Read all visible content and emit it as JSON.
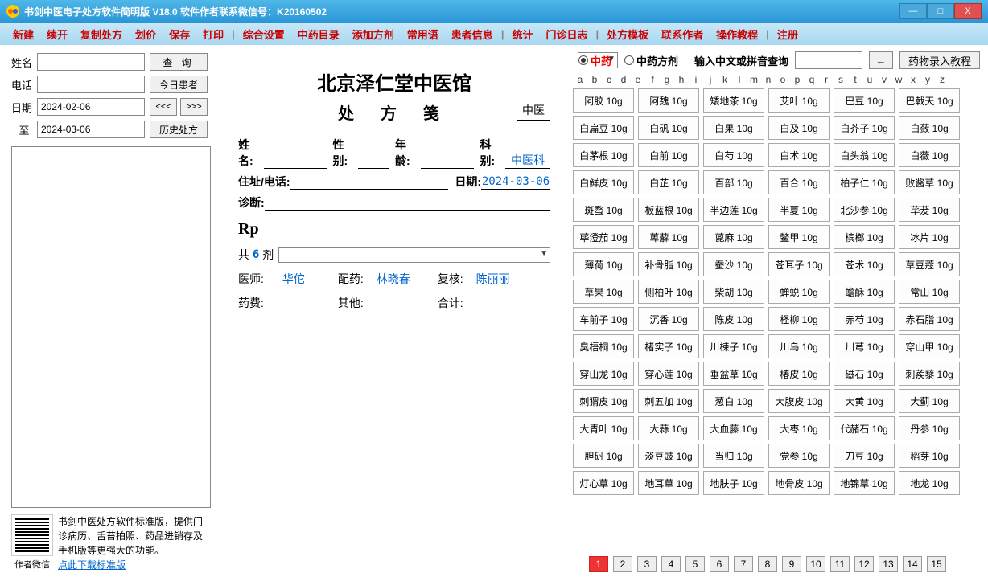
{
  "window": {
    "title": "书剑中医电子处方软件简明版    V18.0         软件作者联系微信号：K20160502",
    "btn_min": "—",
    "btn_max": "□",
    "btn_close": "X"
  },
  "menu": [
    "新建",
    "续开",
    "复制处方",
    "划价",
    "保存",
    "打印",
    "|",
    "综合设置",
    "中药目录",
    "添加方剂",
    "常用语",
    "患者信息",
    "|",
    "统计",
    "门诊日志",
    "|",
    "处方模板",
    "联系作者",
    "操作教程",
    "|",
    "注册"
  ],
  "left": {
    "name_label": "姓名",
    "phone_label": "电话",
    "date_label": "日期",
    "to_label": "至",
    "date_from": "2024-02-06",
    "date_to": "2024-03-06",
    "btn_query": "查   询",
    "btn_today": "今日患者",
    "btn_prev": "<<<",
    "btn_next": ">>>",
    "btn_history": "历史处方",
    "promo": "书剑中医处方软件标准版，提供门诊病历、舌苔拍照、药品进销存及手机版等更强大的功能。",
    "promo_link": "点此下载标准版",
    "qr_caption": "作者微信"
  },
  "rx": {
    "clinic": "北京泽仁堂中医馆",
    "title2": "处 方 笺",
    "stamp": "中医",
    "lab_name": "姓名:",
    "lab_sex": "性别:",
    "lab_age": "年龄:",
    "lab_dept": "科别:",
    "dept": "中医科",
    "lab_addr": "住址/电话:",
    "lab_date": "日期:",
    "date": "2024-03-06",
    "lab_diag": "诊断:",
    "rp": "Rp",
    "total_pre": "共",
    "total_n": "6",
    "total_suf": "剂",
    "lab_doc": "医师:",
    "doc": "华佗",
    "lab_disp": "配药:",
    "disp": "林晓春",
    "lab_check": "复核:",
    "check": "陈丽丽",
    "lab_fee": "药费:",
    "lab_other": "其他:",
    "lab_sum": "合计:"
  },
  "right": {
    "radio1": "中药",
    "radio2": "中药方剂",
    "search_label": "输入中文或拼音查询",
    "arrow": "←",
    "tutorial": "药物录入教程",
    "alpha": [
      "a",
      "b",
      "c",
      "d",
      "e",
      "f",
      "g",
      "h",
      "i",
      "j",
      "k",
      "l",
      "m",
      "n",
      "o",
      "p",
      "q",
      "r",
      "s",
      "t",
      "u",
      "v",
      "w",
      "x",
      "y",
      "z"
    ],
    "herbs": [
      [
        "阿胶 10g",
        "阿魏 10g",
        "矮地茶 10g",
        "艾叶 10g",
        "巴豆 10g",
        "巴戟天 10g"
      ],
      [
        "白扁豆 10g",
        "白矾 10g",
        "白果 10g",
        "白及 10g",
        "白芥子 10g",
        "白蔹 10g"
      ],
      [
        "白茅根 10g",
        "白前 10g",
        "白芍 10g",
        "白术 10g",
        "白头翁 10g",
        "白薇 10g"
      ],
      [
        "白鲜皮 10g",
        "白芷 10g",
        "百部 10g",
        "百合 10g",
        "柏子仁 10g",
        "败酱草 10g"
      ],
      [
        "斑蝥 10g",
        "板蓝根 10g",
        "半边莲 10g",
        "半夏 10g",
        "北沙参 10g",
        "荜茇 10g"
      ],
      [
        "荜澄茄 10g",
        "萆薢 10g",
        "蓖麻 10g",
        "鳖甲 10g",
        "槟榔 10g",
        "冰片 10g"
      ],
      [
        "薄荷 10g",
        "补骨脂 10g",
        "蚕沙 10g",
        "苍耳子 10g",
        "苍术 10g",
        "草豆蔻 10g"
      ],
      [
        "草果 10g",
        "侧柏叶 10g",
        "柴胡 10g",
        "蝉蜕 10g",
        "蟾酥 10g",
        "常山 10g"
      ],
      [
        "车前子 10g",
        "沉香 10g",
        "陈皮 10g",
        "柽柳 10g",
        "赤芍 10g",
        "赤石脂 10g"
      ],
      [
        "臭梧桐 10g",
        "楮实子 10g",
        "川楝子 10g",
        "川乌 10g",
        "川芎 10g",
        "穿山甲 10g"
      ],
      [
        "穿山龙 10g",
        "穿心莲 10g",
        "垂盆草 10g",
        "椿皮 10g",
        "磁石 10g",
        "刺蒺藜 10g"
      ],
      [
        "刺猬皮 10g",
        "刺五加 10g",
        "葱白 10g",
        "大腹皮 10g",
        "大黄 10g",
        "大蓟 10g"
      ],
      [
        "大青叶 10g",
        "大蒜 10g",
        "大血藤 10g",
        "大枣 10g",
        "代赭石 10g",
        "丹参 10g"
      ],
      [
        "胆矾 10g",
        "淡豆豉 10g",
        "当归 10g",
        "党参 10g",
        "刀豆 10g",
        "稻芽 10g"
      ],
      [
        "灯心草 10g",
        "地耳草 10g",
        "地肤子 10g",
        "地骨皮 10g",
        "地锦草 10g",
        "地龙 10g"
      ]
    ],
    "pages": [
      "1",
      "2",
      "3",
      "4",
      "5",
      "6",
      "7",
      "8",
      "9",
      "10",
      "11",
      "12",
      "13",
      "14",
      "15"
    ],
    "active_page": 1
  }
}
